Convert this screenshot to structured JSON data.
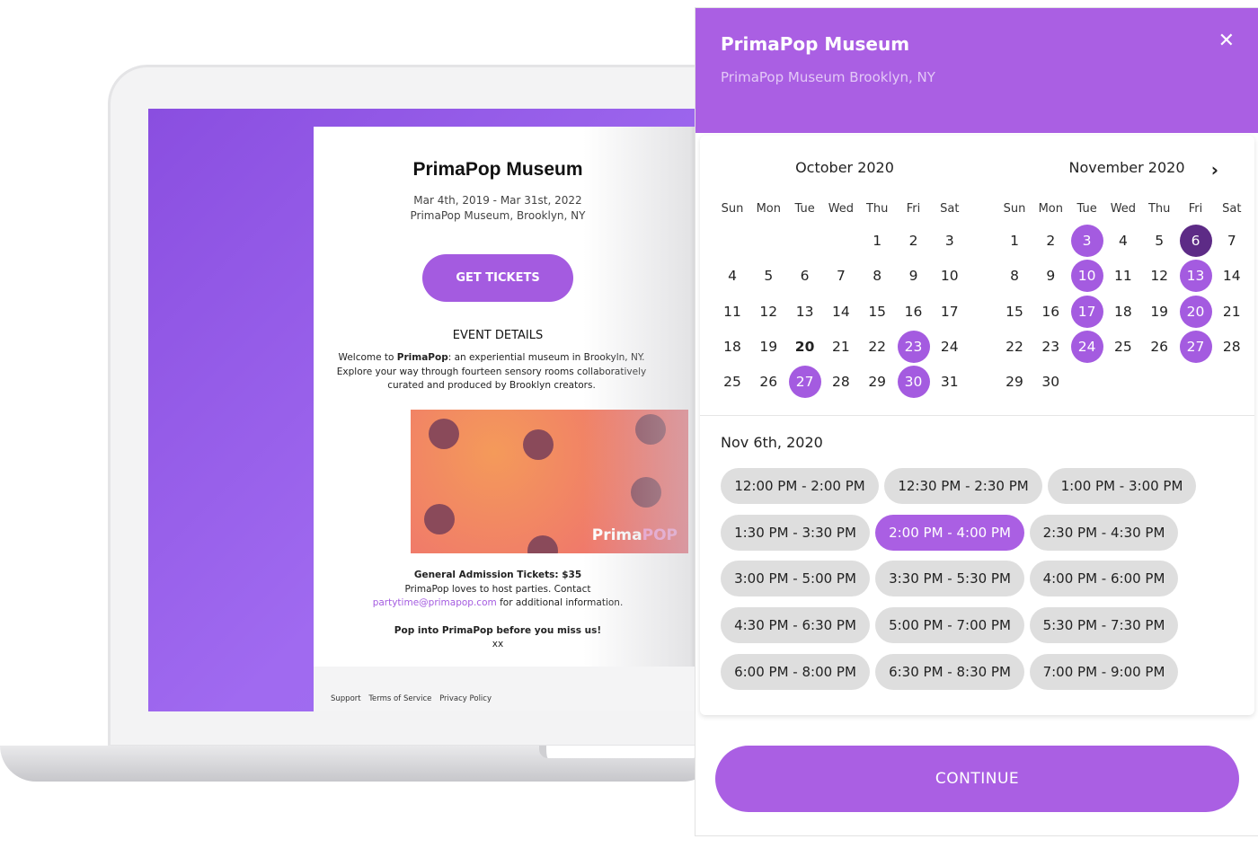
{
  "event_page": {
    "title": "PrimaPop Museum",
    "dates": "Mar 4th, 2019 - Mar 31st, 2022",
    "venue": "PrimaPop Museum, Brooklyn, NY",
    "get_tickets": "GET TICKETS",
    "details_heading": "EVENT DETAILS",
    "desc_1a": "Welcome to ",
    "desc_1b": "PrimaPop",
    "desc_1c": ": an experiential museum in Brookyln, NY.",
    "desc_2": "Explore your way through fourteen sensory rooms collaboratively",
    "desc_3": "curated and produced by Brooklyn creators.",
    "image_logo_a": "Prima",
    "image_logo_b": "POP",
    "tickets_label": "General Admission Tickets:",
    "tickets_price": " $35",
    "party_line": "PrimaPop loves to host parties. Contact",
    "email": "partytime@primapop.com",
    "email_suffix": " for additional information.",
    "closing": "Pop into PrimaPop before you miss us!",
    "signoff": "xx",
    "footer_links": [
      "Support",
      "Terms of Service",
      "Privacy Policy"
    ]
  },
  "panel": {
    "title": "PrimaPop Museum",
    "subtitle": "PrimaPop Museum Brooklyn, NY",
    "close_icon": "close-icon",
    "next_icon": "chevron-right-icon",
    "weekdays": [
      "Sun",
      "Mon",
      "Tue",
      "Wed",
      "Thu",
      "Fri",
      "Sat"
    ],
    "months": [
      {
        "name": "October 2020",
        "first_weekday": 4,
        "days": 31,
        "available": [
          23,
          27,
          30
        ],
        "selected": null,
        "today": 20
      },
      {
        "name": "November 2020",
        "first_weekday": 0,
        "days": 30,
        "available": [
          3,
          6,
          10,
          13,
          17,
          20,
          24,
          27
        ],
        "selected": 6,
        "today": null
      }
    ],
    "selected_date": "Nov 6th, 2020",
    "time_slots": [
      [
        "12:00 PM - 2:00 PM",
        "12:30 PM - 2:30 PM",
        "1:00 PM - 3:00 PM"
      ],
      [
        "1:30 PM - 3:30 PM",
        "2:00 PM - 4:00 PM",
        "2:30 PM - 4:30 PM"
      ],
      [
        "3:00 PM - 5:00 PM",
        "3:30 PM - 5:30 PM",
        "4:00 PM - 6:00 PM"
      ],
      [
        "4:30 PM - 6:30 PM",
        "5:00 PM - 7:00 PM",
        "5:30 PM - 7:30 PM"
      ],
      [
        "6:00 PM - 8:00 PM",
        "6:30 PM - 8:30 PM",
        "7:00 PM - 9:00 PM"
      ]
    ],
    "selected_slot": "2:00 PM - 4:00 PM",
    "continue": "CONTINUE",
    "colors": {
      "accent": "#aa5fe3",
      "selected_day": "#5d2b86",
      "slot_bg": "#dedede"
    }
  }
}
